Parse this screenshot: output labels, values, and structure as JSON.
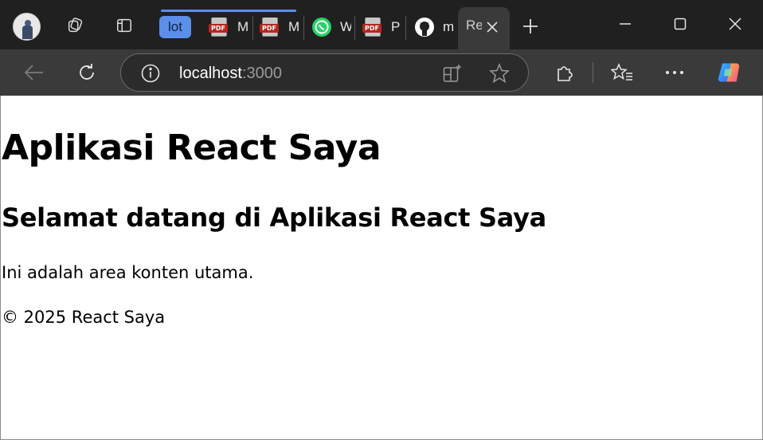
{
  "browser": {
    "tabs": [
      {
        "group_label": "lot",
        "title": ""
      },
      {
        "title": "M",
        "icon": "pdf-icon"
      },
      {
        "title": "M",
        "icon": "pdf-icon"
      },
      {
        "title": "W",
        "icon": "whatsapp-icon"
      },
      {
        "title": "P",
        "icon": "pdf-icon"
      },
      {
        "title": "m",
        "icon": "github-icon"
      },
      {
        "title": "Re",
        "active": true
      }
    ],
    "address_bar": {
      "host": "localhost",
      "port": ":3000"
    },
    "colors": {
      "tabstrip": "#202020",
      "toolbar": "#3a3a3a",
      "group_accent": "#5b8fea"
    }
  },
  "page": {
    "heading": "Aplikasi React Saya",
    "subheading": "Selamat datang di Aplikasi React Saya",
    "content": "Ini adalah area konten utama.",
    "footer": "© 2025 React Saya"
  }
}
